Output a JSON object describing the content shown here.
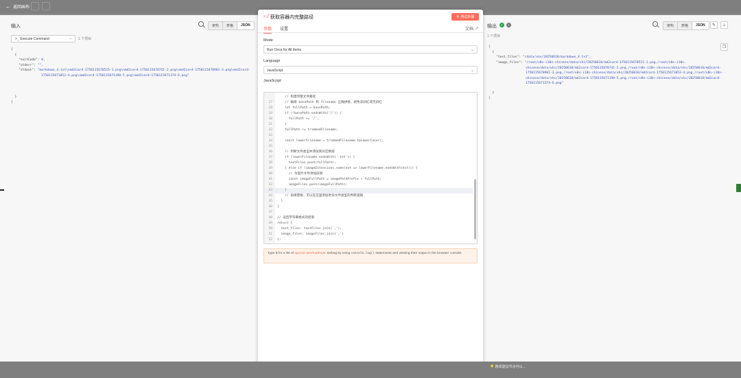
{
  "topbar": {
    "back_label": "返回画布"
  },
  "input_panel": {
    "title": "输入",
    "view_modes": [
      "架构",
      "表格",
      "JSON"
    ],
    "node_select": "Execute Command",
    "items_count": "1 个项目",
    "json": {
      "exitCode_key": "\"exitCode\":",
      "exitCode_val": "0,",
      "stderr_key": "\"stderr\":",
      "stderr_val": "\"\",",
      "stdout_key": "\"stdout\":",
      "stdout_val": "\"markdown_4.txt\\nmd2card-1750115670515-1.png\\nmd2card-1750115670741-2.png\\nmd2card-1750115670901-3.png\\nmd2card-1750115671053-4.png\\nmd2card-1750115671198-5.png\\nmd2card-1750115671374-6.png\""
    }
  },
  "modal": {
    "title": "获取容器内完整路径",
    "execute_label": "测试步骤",
    "tabs": [
      "参数",
      "设置"
    ],
    "docs_label": "文档",
    "mode_label": "Mode",
    "mode_value": "Run Once for All Items",
    "language_label": "Language",
    "language_value": "JavaScript",
    "code_label": "JavaScript",
    "code_lines": [
      {
        "n": "",
        "t": "    // 构建完整文件路径"
      },
      {
        "n": "27",
        "t": "    // 确保 basePath 和 filename 正确拼接，避免双斜杠或无斜杠"
      },
      {
        "n": "28",
        "t": "    let fullPath = basePath;"
      },
      {
        "n": "29",
        "t": "    if (!basePath.endsWith('/')) {"
      },
      {
        "n": "30",
        "t": "      fullPath += '/';"
      },
      {
        "n": "31",
        "t": "    }"
      },
      {
        "n": "32",
        "t": "    fullPath += trimmedFilename;"
      },
      {
        "n": "33",
        "t": ""
      },
      {
        "n": "34",
        "t": "    const lowerFilename = trimmedFilename.toLowerCase();"
      },
      {
        "n": "35",
        "t": ""
      },
      {
        "n": "36",
        "t": "    // 判断文件类型并添加到对应数组"
      },
      {
        "n": "37",
        "t": "    if (lowerFilename.endsWith('.txt')) {"
      },
      {
        "n": "38",
        "t": "      textFiles.push(fullPath);"
      },
      {
        "n": "39",
        "t": "    } else if (imageExtensions.some(ext => lowerFilename.endsWith(ext))) {"
      },
      {
        "n": "40",
        "t": "      // 为图片文件添加前缀"
      },
      {
        "n": "41",
        "t": "      const imageFullPath = imagePathPrefix + fullPath;"
      },
      {
        "n": "42",
        "t": "      imageFiles.push(imageFullPath);"
      },
      {
        "n": "43",
        "t": "    }"
      },
      {
        "n": "44",
        "t": "    // 如果需要，可以在这里添加更多文件类型的判断逻辑"
      },
      {
        "n": "45",
        "t": "  }"
      },
      {
        "n": "46",
        "t": "}"
      },
      {
        "n": "47",
        "t": ""
      },
      {
        "n": "48",
        "t": "// 返回字符串格式的结果"
      },
      {
        "n": "49",
        "t": "return {"
      },
      {
        "n": "50",
        "t": "  text_files: textFiles.join(','),"
      },
      {
        "n": "51",
        "t": "  image_files: imageFiles.join(',')"
      },
      {
        "n": "52",
        "t": "};"
      }
    ],
    "hint_pre": "Type $ for a list of ",
    "hint_link": "special vars/methods",
    "hint_mid": ". Debug by using ",
    "hint_code": "console.log()",
    "hint_post": " statements and viewing their output in the browser console."
  },
  "output_panel": {
    "title": "输出",
    "view_modes": [
      "架构",
      "表格",
      "JSON"
    ],
    "items_count": "1 个项目",
    "json": {
      "text_key": "\"text_files\":",
      "text_val": "\"/data/xhs/20250618/markdown_4.txt\",",
      "image_key": "\"image_files\":",
      "image_val": "\"/root/n8n-i18n-chinese/data/xhs/20250618/md2card-1750115670515-1.png,/root/n8n-i18n-chinese/data/xhs/20250618/md2card-1750115670741-2.png,/root/n8n-i18n-chinese/data/xhs/20250618/md2card-1750115670901-3.png,/root/n8n-i18n-chinese/data/xhs/20250618/md2card-1750115671053-4.png,/root/n8n-i18n-chinese/data/xhs/20250618/md2card-1750115671198-5.png,/root/n8n-i18n-chinese/data/xhs/20250618/md2card-1750115671374-6.png\""
    }
  },
  "bottombar": {
    "tip": "跑单建议节点可以..."
  },
  "colors": {
    "accent": "#ff6d5a",
    "success": "#2da24a"
  }
}
